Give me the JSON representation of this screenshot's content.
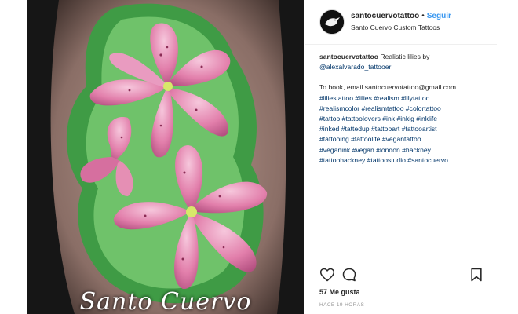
{
  "post": {
    "image_alt": "Realistic lilies tattoo",
    "watermark": "Santo Cuervo"
  },
  "header": {
    "username": "santocuervotattoo",
    "separator": "•",
    "follow_label": "Seguir",
    "subtitle": "Santo Cuervo Custom Tattoos"
  },
  "caption": {
    "username": "santocuervotattoo",
    "text": "Realistic lilies by",
    "mention": "@alexalvarado_tattooer",
    "booking": "To book, email santocuervotattoo@gmail.com",
    "hashtags": [
      "#liliestattoo",
      "#lilies",
      "#realism",
      "#lilytattoo",
      "#realismcolor",
      "#realismtattoo",
      "#colortattoo",
      "#tattoo",
      "#tattoolovers",
      "#ink",
      "#inkig",
      "#inklife",
      "#inked",
      "#tattedup",
      "#tattooart",
      "#tattooartist",
      "#tattooing",
      "#tattoolife",
      "#vegantattoo",
      "#veganink",
      "#vegan",
      "#london",
      "#hackney",
      "#tattoohackney",
      "#tattoostudio",
      "#santocuervo"
    ]
  },
  "actions": {
    "like_icon": "heart-icon",
    "comment_icon": "comment-icon",
    "save_icon": "bookmark-icon"
  },
  "likes": "57 Me gusta",
  "timestamp": "HACE 19 HORAS",
  "colors": {
    "follow": "#3897f0",
    "link": "#003569",
    "lily_pink": "#e58fb4",
    "leaf_green": "#4fa34a"
  }
}
